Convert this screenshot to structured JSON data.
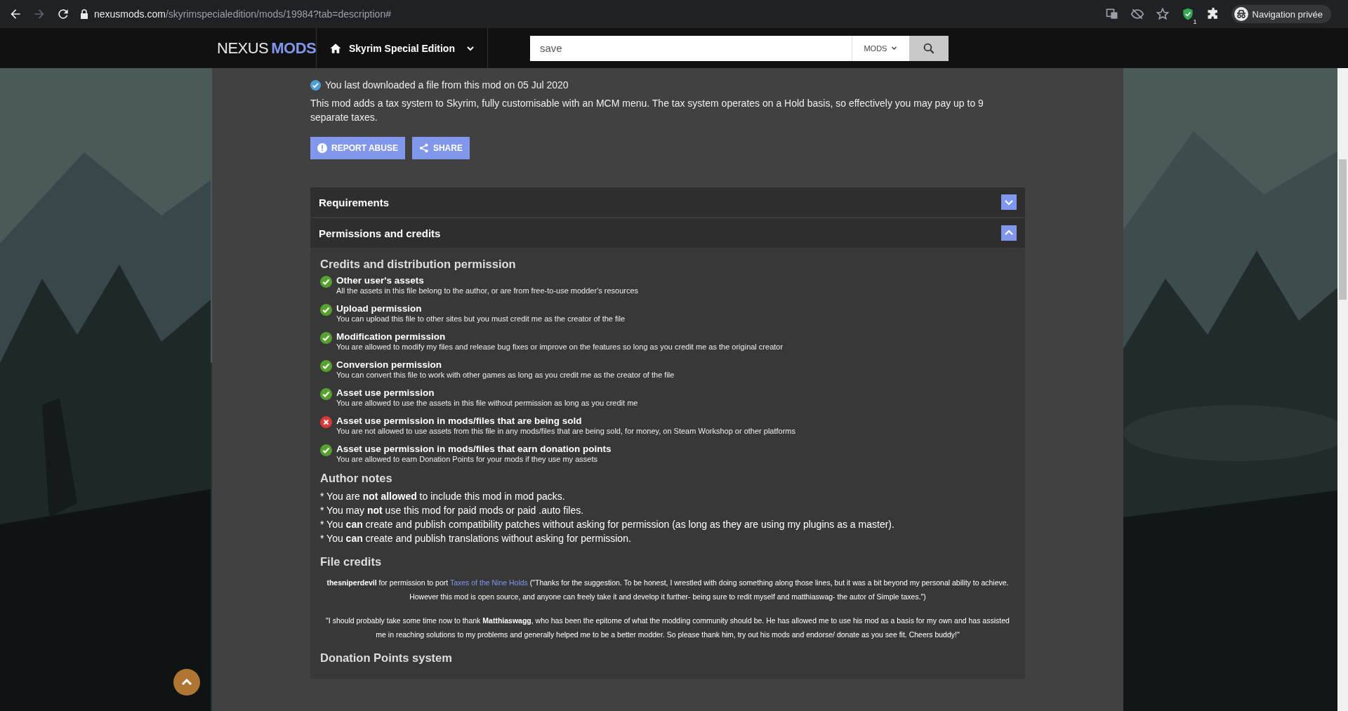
{
  "browser": {
    "url_host": "nexusmods.com",
    "url_path": "/skyrimspecialedition/mods/19984?tab=description#",
    "extension_badge": "1",
    "profile_label": "Navigation privée"
  },
  "header": {
    "logo_left": "NEXUS",
    "logo_right": "MODS",
    "game": "Skyrim Special Edition",
    "search": {
      "value": "save"
    },
    "search_scope": "MODS"
  },
  "download_note": "You last downloaded a file from this mod on 05 Jul 2020",
  "description": "This mod adds a tax system to Skyrim, fully customisable with an MCM menu. The tax system operates on a Hold basis, so effectively you may pay up to 9 separate taxes.",
  "actions": [
    {
      "kind": "report",
      "label": "REPORT ABUSE"
    },
    {
      "kind": "share",
      "label": "SHARE"
    }
  ],
  "sections": [
    {
      "title": "Requirements",
      "expanded": false
    },
    {
      "title": "Permissions and credits",
      "expanded": true
    }
  ],
  "permissions": {
    "title": "Credits and distribution permission",
    "items": [
      {
        "title": "Other user's assets",
        "text": "All the assets in this file belong to the author, or are from free-to-use modder's resources",
        "allowed": true
      },
      {
        "title": "Upload permission",
        "text": "You can upload this file to other sites but you must credit me as the creator of the file",
        "allowed": true
      },
      {
        "title": "Modification permission",
        "text": "You are allowed to modify my files and release bug fixes or improve on the features so long as you credit me as the original creator",
        "allowed": true
      },
      {
        "title": "Conversion permission",
        "text": "You can convert this file to work with other games as long as you credit me as the creator of the file",
        "allowed": true
      },
      {
        "title": "Asset use permission",
        "text": "You are allowed to use the assets in this file without permission as long as you credit me",
        "allowed": true
      },
      {
        "title": "Asset use permission in mods/files that are being sold",
        "text": "You are not allowed to use assets from this file in any mods/files that are being sold, for money, on Steam Workshop or other platforms",
        "allowed": false
      },
      {
        "title": "Asset use permission in mods/files that earn donation points",
        "text": "You are allowed to earn Donation Points for your mods if they use my assets",
        "allowed": true
      }
    ]
  },
  "author_notes": {
    "title": "Author notes",
    "lines": [
      "* You are **not allowed** to include this mod in mod packs.",
      "* You may **not** use this mod for paid mods or paid .auto files.",
      "* You **can** create and publish compatibility patches without asking for permission (as long as they are using my plugins as a master).",
      "* You **can** create and publish translations without asking for permission."
    ]
  },
  "file_credits": {
    "title": "File credits",
    "paragraphs": [
      {
        "segments": [
          {
            "kind": "text",
            "text": "**thesniperdevil** for permission to port "
          },
          {
            "kind": "link",
            "text": "Taxes of the Nine Holds"
          },
          {
            "kind": "text",
            "text": " (\"Thanks for the suggestion. To be honest, I wrestled with doing something along those lines, but it was a bit beyond my personal ability to achieve. However this mod is open source, and anyone can freely take it and develop it further- being sure to redit myself and matthiaswag- the autor of Simple taxes.\")"
          }
        ]
      },
      {
        "segments": [
          {
            "kind": "text",
            "text": "\"I should probably take some time now to thank **Matthiaswagg**, who has been the epitome of what the modding community should be. He has allowed me to use his mod as a basis for my own and has assisted me in reaching solutions to my problems and generally helped me to be a better modder. So please thank him, try out his mods and endorse/ donate as you see fit.  Cheers buddy!\""
          }
        ]
      }
    ]
  },
  "donation_title": "Donation Points system"
}
